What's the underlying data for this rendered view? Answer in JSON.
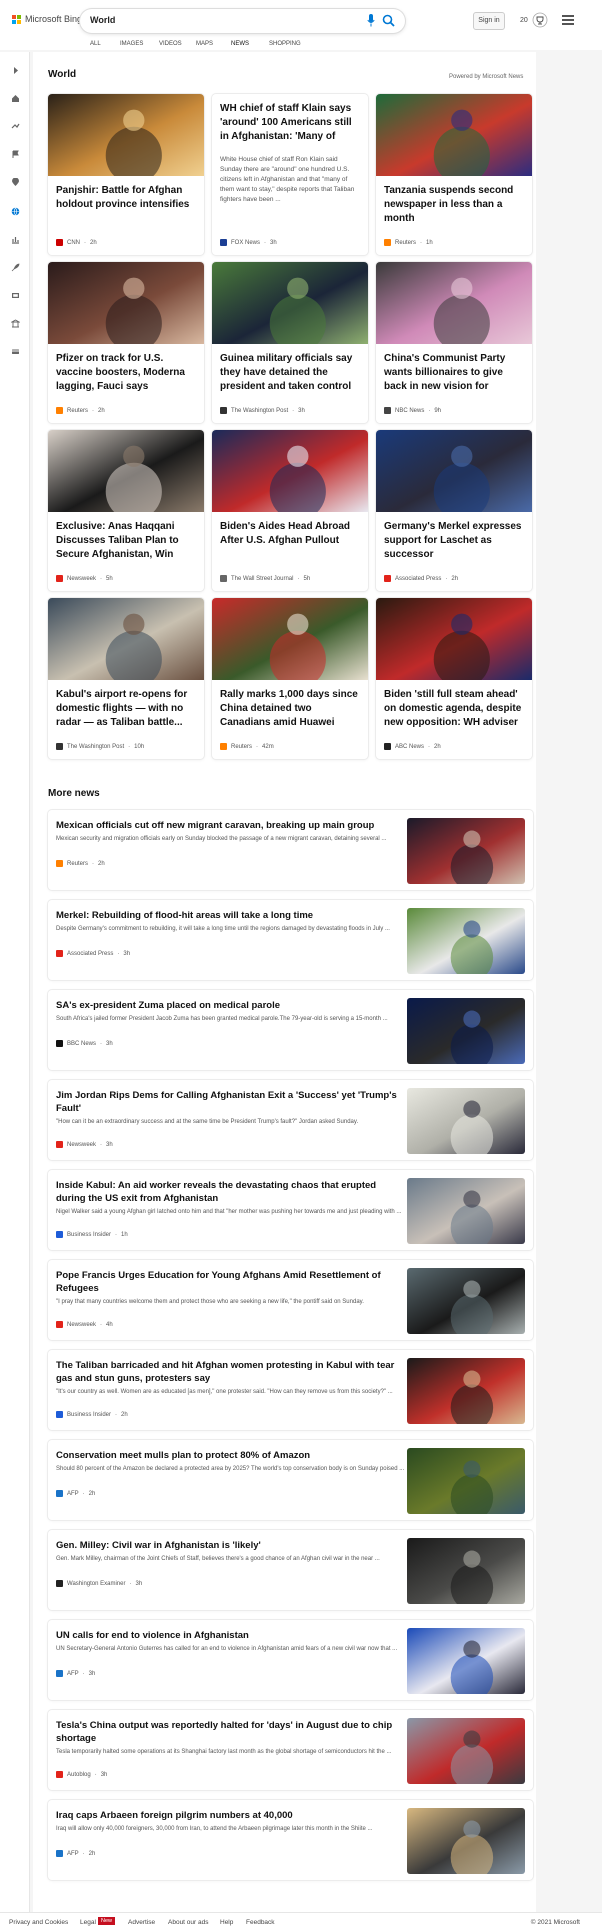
{
  "header": {
    "logo_text": "Microsoft Bing",
    "search_value": "World",
    "signin_label": "Sign in",
    "rewards_points": "20"
  },
  "tabs": [
    "ALL",
    "IMAGES",
    "VIDEOS",
    "MAPS",
    "NEWS",
    "SHOPPING"
  ],
  "active_tab": "NEWS",
  "rail_icons": [
    "expand-icon",
    "home-icon",
    "exchange-icon",
    "flag-icon",
    "location-icon",
    "globe-icon",
    "chart-icon",
    "rocket-icon",
    "film-icon",
    "building-icon",
    "card-icon"
  ],
  "world": {
    "title": "World",
    "powered_by": "Powered by Microsoft News",
    "cards": [
      {
        "title": "Panjshir: Battle for Afghan holdout province intensifies",
        "source": "CNN",
        "time": "2h",
        "source_color": "#cc0000",
        "image_colors": [
          "#2a2118",
          "#c98a3a",
          "#f0d090"
        ]
      },
      {
        "title": "WH chief of staff Klain says 'around' 100 Americans still in Afghanistan: 'Many of them...",
        "snippet": "White House chief of staff Ron Klain said Sunday there are \"around\" one hundred U.S. citizens left in Afghanistan and that \"many of them want to stay,\" despite reports that Taliban fighters have been ...",
        "source": "FOX News",
        "time": "3h",
        "source_color": "#1c3f94"
      },
      {
        "title": "Tanzania suspends second newspaper in less than a month",
        "source": "Reuters",
        "time": "1h",
        "source_color": "#ff8000",
        "image_colors": [
          "#1d6b3a",
          "#c83a2c",
          "#2c2c80"
        ]
      },
      {
        "title": "Pfizer on track for U.S. vaccine boosters, Moderna lagging, Fauci says",
        "source": "Reuters",
        "time": "2h",
        "source_color": "#ff8000",
        "image_colors": [
          "#2a1b1b",
          "#7a4a3a",
          "#d8b8a0"
        ]
      },
      {
        "title": "Guinea military officials say they have detained the president and taken control of...",
        "source": "The Washington Post",
        "time": "3h",
        "source_color": "#333333",
        "image_colors": [
          "#4a7a3a",
          "#1b2538",
          "#8fb070"
        ]
      },
      {
        "title": "China's Communist Party wants billionaires to give back in new vision for society",
        "source": "NBC News",
        "time": "9h",
        "source_color": "#444444",
        "image_colors": [
          "#3a3a3a",
          "#d08ab8",
          "#e8c8d8"
        ]
      },
      {
        "title": "Exclusive: Anas Haqqani Discusses Taliban Plan to Secure Afghanistan, Win Worl...",
        "source": "Newsweek",
        "time": "5h",
        "source_color": "#e2231a",
        "image_colors": [
          "#d8d0c8",
          "#1a1a1a",
          "#8a7a6a"
        ]
      },
      {
        "title": "Biden's Aides Head Abroad After U.S. Afghan Pullout",
        "source": "The Wall Street Journal",
        "time": "5h",
        "source_color": "#666666",
        "image_colors": [
          "#1a2a5a",
          "#c02a2a",
          "#e8e8f0"
        ]
      },
      {
        "title": "Germany's Merkel expresses support for Laschet as successor",
        "source": "Associated Press",
        "time": "2h",
        "source_color": "#e2231a",
        "image_colors": [
          "#1a3a7a",
          "#2a2a3a",
          "#4a6aa8"
        ]
      },
      {
        "title": "Kabul's airport re-opens for domestic flights — with no radar — as Taliban battle...",
        "source": "The Washington Post",
        "time": "10h",
        "source_color": "#333333",
        "image_colors": [
          "#3a4a5a",
          "#c8c0b0",
          "#6a5040"
        ]
      },
      {
        "title": "Rally marks 1,000 days since China detained two Canadians amid Huawei dispute",
        "source": "Reuters",
        "time": "42m",
        "source_color": "#ff8000",
        "image_colors": [
          "#c82a2a",
          "#3a5a2a",
          "#e8e0d0"
        ]
      },
      {
        "title": "Biden 'still full steam ahead' on domestic agenda, despite new opposition: WH adviser",
        "source": "ABC News",
        "time": "2h",
        "source_color": "#222222",
        "image_colors": [
          "#2a1a10",
          "#c02a2a",
          "#1a2a6a"
        ]
      }
    ]
  },
  "more_news": {
    "title": "More news",
    "items": [
      {
        "title": "Mexican officials cut off new migrant caravan, breaking up main group",
        "snippet": "Mexican security and migration officials early on Sunday blocked the passage of a new migrant caravan, detaining several ...",
        "source": "Reuters",
        "time": "2h",
        "source_color": "#ff8000",
        "image_colors": [
          "#1a1a2a",
          "#a03030",
          "#d0c0b0"
        ]
      },
      {
        "title": "Merkel: Rebuilding of flood-hit areas will take a long time",
        "snippet": "Despite Germany's commitment to rebuilding, it will take a long time until the regions damaged by devastating floods in July ...",
        "source": "Associated Press",
        "time": "3h",
        "source_color": "#e2231a",
        "image_colors": [
          "#5a8a3a",
          "#e8e8e8",
          "#2a4a8a"
        ]
      },
      {
        "title": "SA's ex-president Zuma placed on medical parole",
        "snippet": "South Africa's jailed former President Jacob Zuma has been granted medical parole.The 79-year-old is serving a 15-month ...",
        "source": "BBC News",
        "time": "3h",
        "source_color": "#111111",
        "image_colors": [
          "#0a1a4a",
          "#2a2a2a",
          "#4a6ab8"
        ]
      },
      {
        "title": "Jim Jordan Rips Dems for Calling Afghanistan Exit a 'Success' yet 'Trump's Fault'",
        "snippet": "\"How can it be an extraordinary success and at the same time be President Trump's fault?\" Jordan asked Sunday.",
        "source": "Newsweek",
        "time": "3h",
        "source_color": "#e2231a",
        "image_colors": [
          "#e8e8e0",
          "#b0b0a8",
          "#2a2a3a"
        ]
      },
      {
        "title": "Inside Kabul: An aid worker reveals the devastating chaos that erupted during the US exit from Afghanistan",
        "snippet": "Nigel Walker said a young Afghan girl latched onto him and that \"her mother was pushing her towards me and just pleading with ...",
        "source": "Business Insider",
        "time": "1h",
        "source_color": "#1e5cd8",
        "image_colors": [
          "#6a7a8a",
          "#c8c0b8",
          "#3a3a4a"
        ]
      },
      {
        "title": "Pope Francis Urges Education for Young Afghans Amid Resettlement of Refugees",
        "snippet": "\"I pray that many countries welcome them and protect those who are seeking a new life,\" the pontiff said on Sunday.",
        "source": "Newsweek",
        "time": "4h",
        "source_color": "#e2231a",
        "image_colors": [
          "#5a6a70",
          "#1a1a1a",
          "#a8b0b0"
        ]
      },
      {
        "title": "The Taliban barricaded and hit Afghan women protesting in Kabul with tear gas and stun guns, protesters say",
        "snippet": "\"It's our country as well. Women are as educated [as men],\" one protester said. \"How can they remove us from this society?\" ...",
        "source": "Business Insider",
        "time": "2h",
        "source_color": "#1e5cd8",
        "image_colors": [
          "#1a1a1a",
          "#c0302a",
          "#d8b890"
        ]
      },
      {
        "title": "Conservation meet mulls plan to protect 80% of Amazon",
        "snippet": "Should 80 percent of the Amazon be declared a protected area by 2025? The world's top conservation body is on Sunday poised ...",
        "source": "AFP",
        "time": "2h",
        "source_color": "#1a73c8",
        "image_colors": [
          "#2a4a20",
          "#6a7a2a",
          "#3a5a6a"
        ]
      },
      {
        "title": "Gen. Milley: Civil war in Afghanistan is 'likely'",
        "snippet": "Gen. Mark Milley, chairman of the Joint Chiefs of Staff, believes there's a good chance of an Afghan civil war in the near ...",
        "source": "Washington Examiner",
        "time": "3h",
        "source_color": "#222222",
        "image_colors": [
          "#1a1a1a",
          "#4a4a48",
          "#a8a8a0"
        ]
      },
      {
        "title": "UN calls for end to violence in Afghanistan",
        "snippet": "UN Secretary-General Antonio Guterres has called for an end to violence in Afghanistan amid fears of a new civil war now that ...",
        "source": "AFP",
        "time": "3h",
        "source_color": "#1a73c8",
        "image_colors": [
          "#1a4ab8",
          "#e8e8f0",
          "#2a2a3a"
        ]
      },
      {
        "title": "Tesla's China output was reportedly halted for 'days' in August due to chip shortage",
        "snippet": "Tesla temporarily halted some operations at its Shanghai factory last month as the global shortage of semiconductors hit the ...",
        "source": "Autoblog",
        "time": "3h",
        "source_color": "#e2231a",
        "image_colors": [
          "#8a98a8",
          "#c02a2a",
          "#3a3a40"
        ]
      },
      {
        "title": "Iraq caps Arbaeen foreign pilgrim numbers at 40,000",
        "snippet": "Iraq will allow only 40,000 foreigners, 30,000 from Iran, to attend the Arbaeen pilgrimage later this month in the Shiite ...",
        "source": "AFP",
        "time": "2h",
        "source_color": "#1a73c8",
        "image_colors": [
          "#d8b880",
          "#3a3a3a",
          "#8a9aa8"
        ]
      }
    ]
  },
  "footer": {
    "links": [
      "Privacy and Cookies",
      "Legal",
      "Advertise",
      "About our ads",
      "Help",
      "Feedback"
    ],
    "new_badge": "New",
    "copyright": "© 2021 Microsoft"
  },
  "colors": {
    "accent": "#0078d4",
    "logo_red": "#f25022",
    "logo_green": "#7fba00",
    "logo_blue": "#00a4ef",
    "logo_yellow": "#ffb900"
  }
}
